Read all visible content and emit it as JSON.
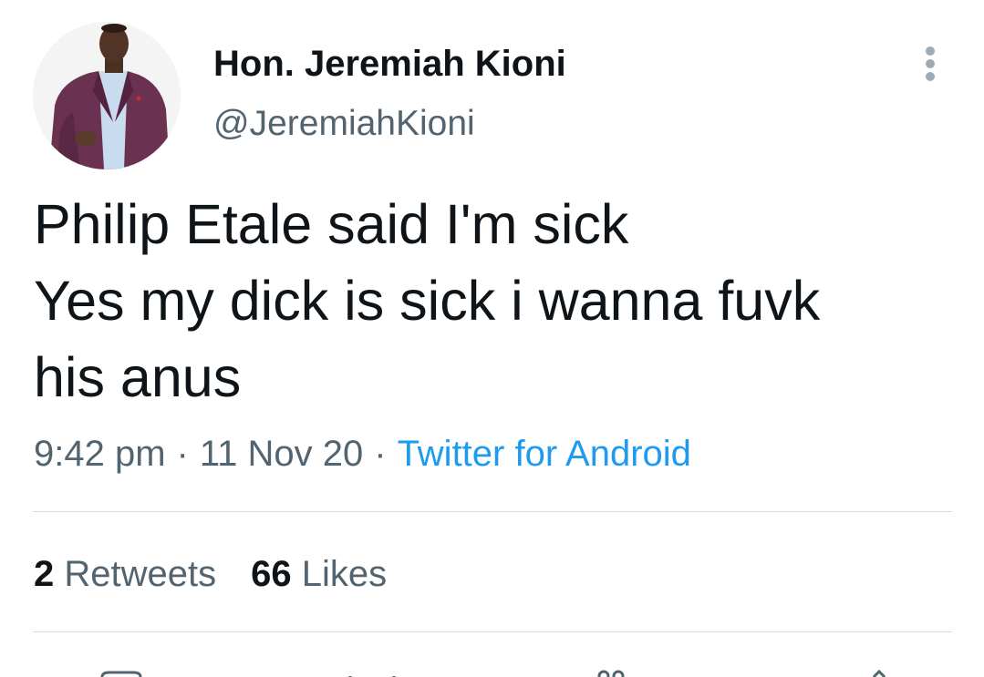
{
  "tweet": {
    "author": {
      "display_name": "Hon. Jeremiah Kioni",
      "handle": "@JeremiahKioni"
    },
    "text_lines": [
      "Philip Etale said I'm sick",
      "Yes my dick is sick i wanna fuvk",
      "his anus"
    ],
    "time": "9:42 pm",
    "separator": "·",
    "date": "11 Nov 20",
    "source": "Twitter for Android",
    "stats": {
      "retweets_count": "2",
      "retweets_label": "Retweets",
      "likes_count": "66",
      "likes_label": "Likes"
    }
  },
  "icons": {
    "more": "more-vertical-icon",
    "reply": "reply-icon",
    "retweet": "retweet-icon",
    "like": "heart-icon",
    "share": "share-icon"
  },
  "colors": {
    "text_primary": "#0f1419",
    "text_secondary": "#536471",
    "link": "#1d9bf0",
    "divider": "#d6dde2"
  }
}
